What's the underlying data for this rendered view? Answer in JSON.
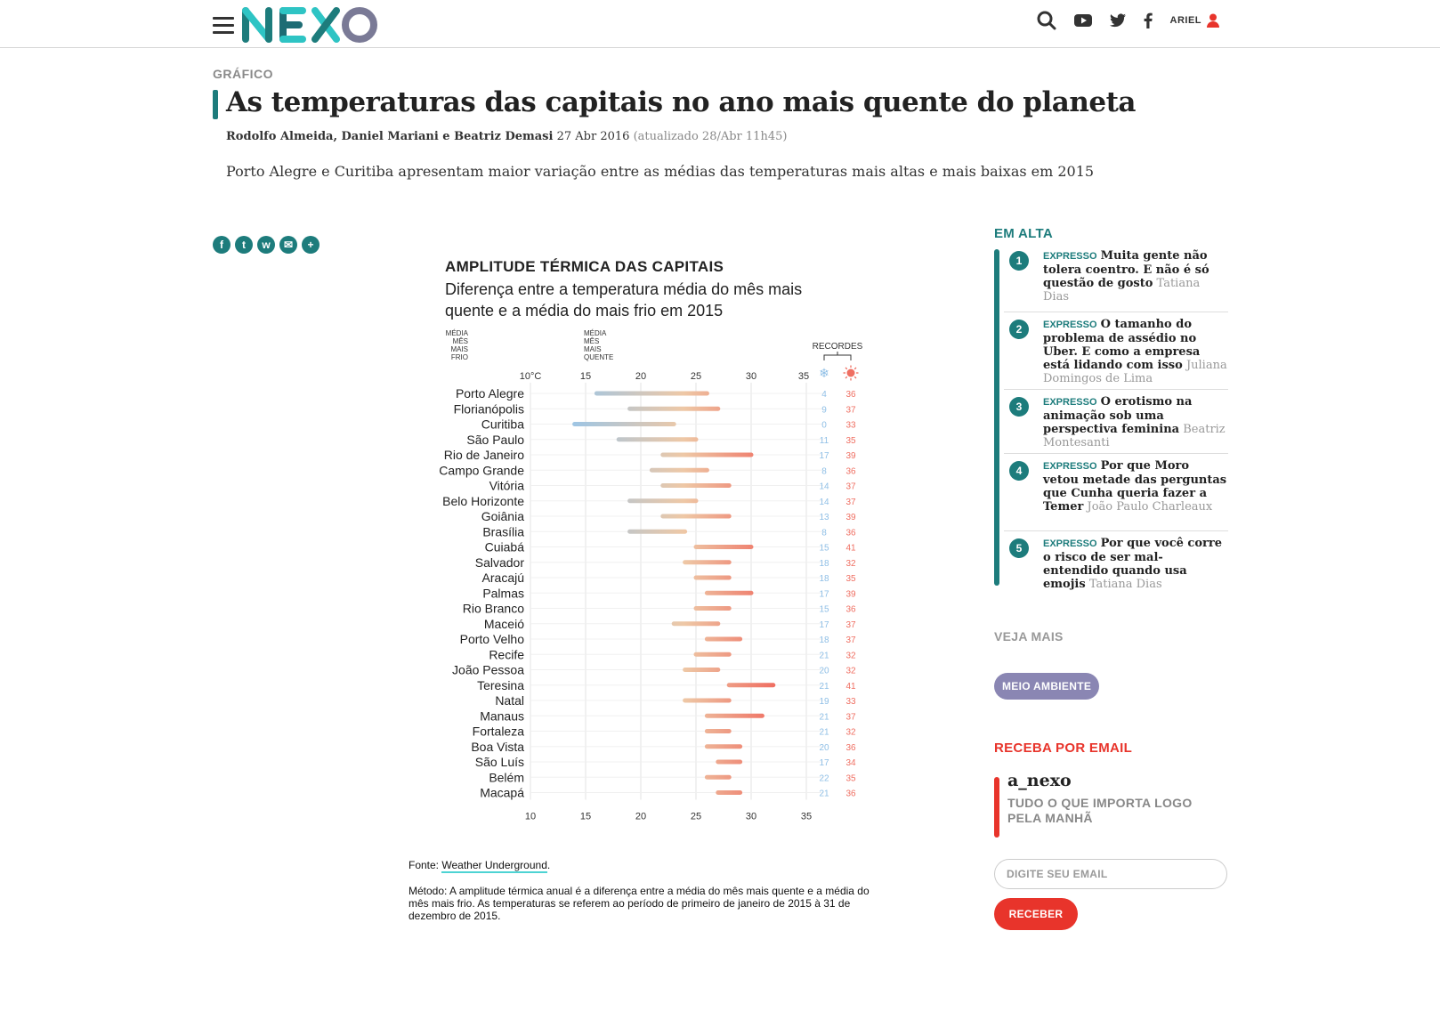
{
  "header": {
    "logo": "NEXO",
    "user_name": "ARIEL",
    "icons": [
      "menu-icon",
      "search-icon",
      "youtube-icon",
      "twitter-icon",
      "facebook-icon",
      "user-icon"
    ]
  },
  "article": {
    "kicker": "GRÁFICO",
    "title": "As temperaturas das capitais no ano mais quente do planeta",
    "authors": "Rodolfo Almeida, Daniel Mariani e Beatriz Demasi",
    "date": "27 Abr 2016",
    "updated": "(atualizado 28/Abr 11h45)",
    "dek": "Porto Alegre e Curitiba apresentam maior variação entre as médias das temperaturas mais altas e mais baixas em 2015",
    "share_icons": [
      "facebook-icon",
      "twitter-icon",
      "whatsapp-icon",
      "email-icon",
      "plus-icon"
    ]
  },
  "chart_data": {
    "type": "range-bar",
    "title": "AMPLITUDE TÉRMICA DAS CAPITAIS",
    "subtitle": "Diferença entre a temperatura média do mês mais quente e a média do mais frio em 2015",
    "legend": {
      "cold": "MÉDIA MÊS MAIS FRIO",
      "hot": "MÉDIA MÊS MAIS QUENTE"
    },
    "records_label": "RECORDES",
    "colors": {
      "cold": "#9fc5e3",
      "mid": "#eec8a6",
      "hot": "#ef6f62",
      "record_low": "#8fbfe6",
      "record_high": "#ef6f62",
      "grid": "#e3e3e3"
    },
    "x_ticks_top": [
      "10°C",
      "15",
      "20",
      "25",
      "30",
      "35"
    ],
    "x_ticks_bottom": [
      "10",
      "15",
      "20",
      "25",
      "30",
      "35"
    ],
    "xlim": [
      10,
      35
    ],
    "cities": [
      "Porto Alegre",
      "Florianópolis",
      "Curitiba",
      "São Paulo",
      "Rio de Janeiro",
      "Campo Grande",
      "Vitória",
      "Belo Horizonte",
      "Goiânia",
      "Brasília",
      "Cuiabá",
      "Salvador",
      "Aracajú",
      "Palmas",
      "Rio Branco",
      "Maceió",
      "Porto Velho",
      "Recife",
      "João Pessoa",
      "Teresina",
      "Natal",
      "Manaus",
      "Fortaleza",
      "Boa Vista",
      "São Luís",
      "Belém",
      "Macapá"
    ],
    "min": [
      16,
      19,
      14,
      18,
      22,
      21,
      22,
      19,
      22,
      19,
      25,
      24,
      25,
      26,
      25,
      23,
      26,
      25,
      24,
      28,
      24,
      26,
      26,
      26,
      27,
      26,
      27
    ],
    "max": [
      26,
      27,
      23,
      25,
      30,
      26,
      28,
      25,
      28,
      24,
      30,
      28,
      28,
      30,
      28,
      27,
      29,
      28,
      27,
      32,
      28,
      31,
      28,
      29,
      29,
      28,
      29
    ],
    "record_low": [
      "4",
      "9",
      "0",
      "11",
      "17",
      "8",
      "14",
      "14",
      "13",
      "8",
      "15",
      "18",
      "18",
      "17",
      "15",
      "17",
      "18",
      "21",
      "20",
      "21",
      "19",
      "21",
      "21",
      "20",
      "17",
      "22",
      "21"
    ],
    "record_high": [
      "36",
      "37",
      "33",
      "35",
      "39",
      "36",
      "37",
      "37",
      "39",
      "36",
      "41",
      "32",
      "35",
      "39",
      "36",
      "37",
      "37",
      "32",
      "32",
      "41",
      "33",
      "37",
      "32",
      "36",
      "34",
      "35",
      "36"
    ]
  },
  "source": {
    "label": "Fonte: ",
    "link": "Weather Underground",
    "suffix": "."
  },
  "method": "Método: A amplitude térmica anual é a diferença entre a média do mês mais quente e a média do mês mais frio. As temperaturas se referem ao período de primeiro de janeiro de 2015 à 31 de dezembro de 2015.",
  "sidebar": {
    "em_alta": "EM ALTA",
    "trending": [
      {
        "num": "1",
        "tag": "EXPRESSO",
        "headline": "Muita gente não tolera coentro. E não é só questão de gosto",
        "author": "Tatiana Dias"
      },
      {
        "num": "2",
        "tag": "EXPRESSO",
        "headline": "O tamanho do problema de assédio no Uber. E como a empresa está lidando com isso",
        "author": "Juliana Domingos de Lima"
      },
      {
        "num": "3",
        "tag": "EXPRESSO",
        "headline": "O erotismo na animação sob uma perspectiva feminina",
        "author": "Beatriz Montesanti"
      },
      {
        "num": "4",
        "tag": "EXPRESSO",
        "headline": "Por que Moro vetou metade das perguntas que Cunha queria fazer a Temer",
        "author": "João Paulo Charleaux"
      },
      {
        "num": "5",
        "tag": "EXPRESSO",
        "headline": "Por que você corre o risco de ser mal-entendido quando usa emojis",
        "author": "Tatiana Dias"
      }
    ],
    "veja_mais": "VEJA MAIS",
    "tag_pill": "MEIO AMBIENTE",
    "receba": "RECEBA POR EMAIL",
    "newsletter_name": "a_nexo",
    "newsletter_desc": "TUDO O QUE IMPORTA LOGO PELA MANHÃ",
    "email_placeholder": "DIGITE SEU EMAIL",
    "submit_label": "RECEBER"
  }
}
